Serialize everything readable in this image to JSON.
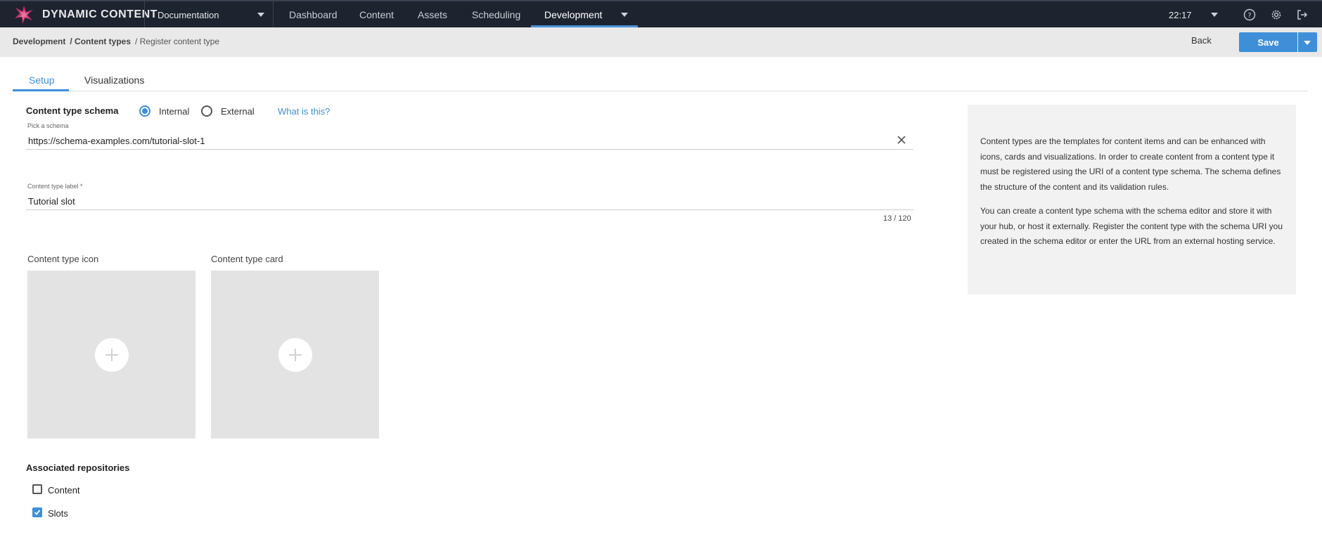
{
  "app": {
    "brand": "DYNAMIC CONTENT",
    "hub": "Documentation",
    "nav": [
      "Dashboard",
      "Content",
      "Assets",
      "Scheduling",
      "Development"
    ],
    "active_nav": "Development",
    "time": "22:17",
    "accent": "#3e8fd8"
  },
  "breadcrumb": {
    "items": [
      "Development",
      "/ Content types",
      "/ Register content type"
    ]
  },
  "actions": {
    "back": "Back",
    "save": "Save"
  },
  "tabs": [
    "Setup",
    "Visualizations"
  ],
  "form": {
    "schema_title": "Content type schema",
    "schema_options": [
      "Internal",
      "External"
    ],
    "schema_selected": "Internal",
    "what_is_this": "What is this?",
    "schema_caption": "Pick a schema",
    "schema_value": "https://schema-examples.com/tutorial-slot-1",
    "label_caption": "Content type label *",
    "label_value": "Tutorial slot",
    "label_counter": "13 / 120",
    "icon_label": "Content type icon",
    "card_label": "Content type card",
    "repos_title": "Associated repositories",
    "repos": [
      {
        "label": "Content",
        "checked": false
      },
      {
        "label": "Slots",
        "checked": true
      }
    ]
  },
  "info": {
    "p1": "Content types are the templates for content items and can be enhanced with icons, cards and visualizations. In order to create content from a content type it must be registered using the URI of a content type schema. The schema defines the structure of the content and its validation rules.",
    "p2": "You can create a content type schema with the schema editor and store it with your hub, or host it externally. Register the content type with the schema URI you created in the schema editor or enter the URL from an external hosting service."
  },
  "icons": [
    "logo-icon",
    "caret-down-icon",
    "help-icon",
    "gear-icon",
    "logout-icon",
    "close-icon",
    "plus-icon",
    "check-icon"
  ]
}
